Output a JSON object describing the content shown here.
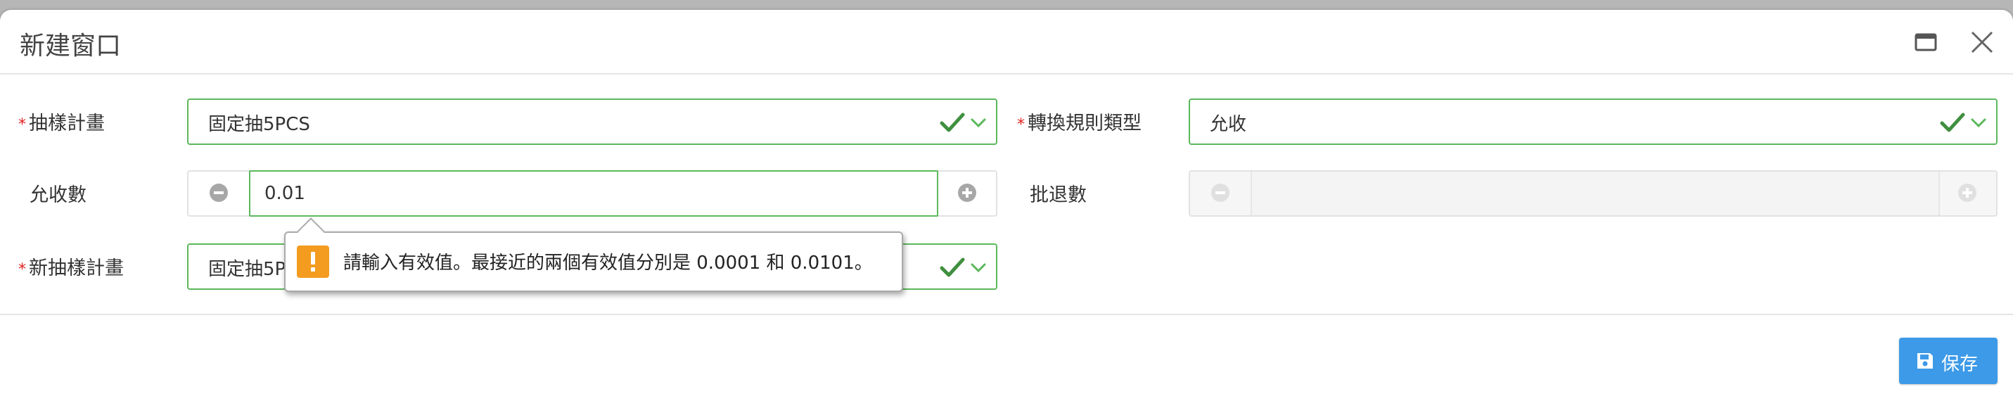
{
  "window": {
    "title": "新建窗口"
  },
  "form": {
    "required_mark": "*",
    "sampling_plan": {
      "label": "抽樣計畫",
      "value": "固定抽5PCS"
    },
    "conversion_rule": {
      "label": "轉換規則類型",
      "value": "允收"
    },
    "accept_count": {
      "label": "允收數",
      "value": "0.01"
    },
    "reject_count": {
      "label": "批退數",
      "value": ""
    },
    "new_sampling_plan": {
      "label": "新抽樣計畫",
      "value": "固定抽5PCS"
    }
  },
  "validation": {
    "message": "請輸入有效值。最接近的兩個有效值分別是 0.0001 和 0.0101。"
  },
  "footer": {
    "save_label": "保存"
  },
  "colors": {
    "valid_border": "#5cb85c",
    "required": "#e02020",
    "warning": "#f39c1f",
    "primary": "#3d9ae8"
  },
  "icons": [
    "maximize-icon",
    "close-icon",
    "check-icon",
    "chevron-down-icon",
    "minus-circle-icon",
    "plus-circle-icon",
    "warning-icon",
    "save-icon"
  ]
}
